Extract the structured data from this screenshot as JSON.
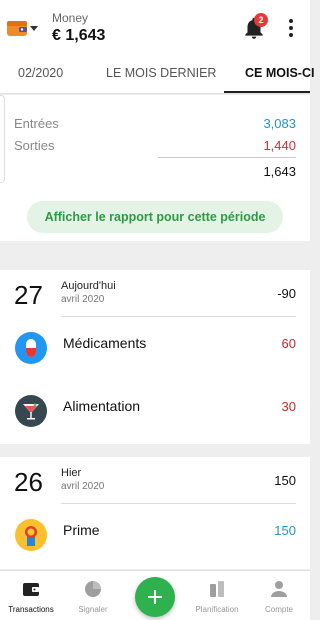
{
  "header": {
    "wallet_name": "Money",
    "wallet_balance": "€ 1,643",
    "notification_count": "2"
  },
  "tabs": [
    {
      "label": "02/2020"
    },
    {
      "label": "LE MOIS DERNIER"
    },
    {
      "label": "CE MOIS-CI",
      "active": true
    }
  ],
  "summary": {
    "income_label": "Entrées",
    "income_value": "3,083",
    "expense_label": "Sorties",
    "expense_value": "1,440",
    "total_value": "1,643",
    "report_button": "Afficher le rapport pour cette période"
  },
  "days": [
    {
      "day": "27",
      "label": "Aujourd'hui",
      "month": "avril 2020",
      "total": "-90",
      "transactions": [
        {
          "category": "Médicaments",
          "amount": "60",
          "icon": "medicine-icon",
          "type": "expense"
        },
        {
          "category": "Alimentation",
          "amount": "30",
          "icon": "cocktail-icon",
          "type": "expense"
        }
      ]
    },
    {
      "day": "26",
      "label": "Hier",
      "month": "avril 2020",
      "total": "150",
      "transactions": [
        {
          "category": "Prime",
          "amount": "150",
          "icon": "award-medal-icon",
          "type": "income"
        }
      ]
    }
  ],
  "nav": [
    {
      "label": "Transactions",
      "icon": "wallet-icon",
      "active": true
    },
    {
      "label": "Signaler",
      "icon": "pie-chart-icon"
    },
    {
      "label": "Planification",
      "icon": "planning-icon"
    },
    {
      "label": "Compte",
      "icon": "account-icon"
    }
  ],
  "colors": {
    "income": "#2196c9",
    "expense": "#c62828",
    "accent": "#2fb14e"
  }
}
